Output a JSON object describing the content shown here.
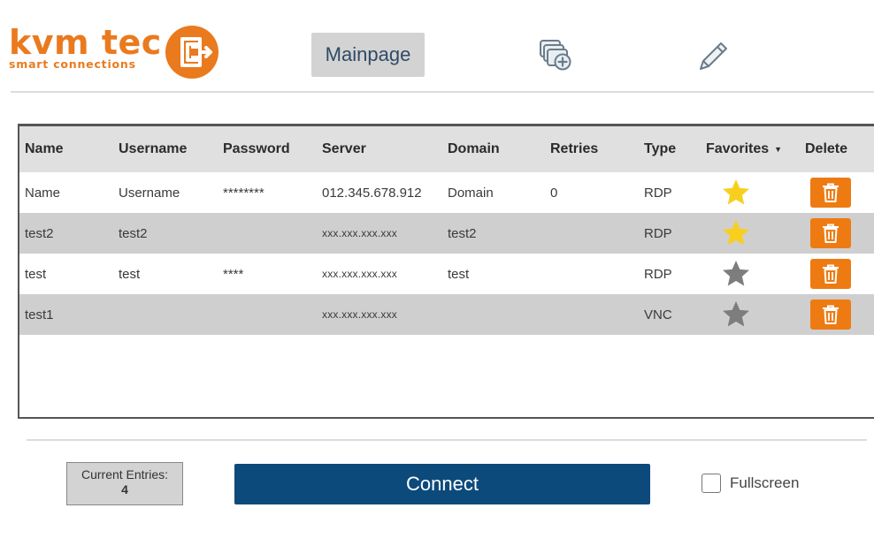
{
  "brand": {
    "name": "kvm tec",
    "tagline": "smart connections",
    "color": "#ea7a1e"
  },
  "nav": {
    "mainpage_label": "Mainpage",
    "add_icon": "add-connection-icon",
    "edit_icon": "pencil-icon"
  },
  "table": {
    "headers": {
      "name": "Name",
      "username": "Username",
      "password": "Password",
      "server": "Server",
      "domain": "Domain",
      "retries": "Retries",
      "type": "Type",
      "favorites": "Favorites",
      "delete": "Delete"
    },
    "rows": [
      {
        "name": "Name",
        "username": "Username",
        "password": "********",
        "server": "012.345.678.912",
        "domain": "Domain",
        "retries": "0",
        "type": "RDP",
        "favorite": true
      },
      {
        "name": "test2",
        "username": "test2",
        "password": "",
        "server": "xxx.xxx.xxx.xxx",
        "domain": "test2",
        "retries": "",
        "type": "RDP",
        "favorite": true
      },
      {
        "name": "test",
        "username": "test",
        "password": "****",
        "server": "xxx.xxx.xxx.xxx",
        "domain": "test",
        "retries": "",
        "type": "RDP",
        "favorite": false
      },
      {
        "name": "test1",
        "username": "",
        "password": "",
        "server": "xxx.xxx.xxx.xxx",
        "domain": "",
        "retries": "",
        "type": "VNC",
        "favorite": false
      }
    ]
  },
  "footer": {
    "entries_label": "Current Entries:",
    "entries_count": "4",
    "connect_label": "Connect",
    "fullscreen_label": "Fullscreen",
    "fullscreen_checked": false
  },
  "colors": {
    "accent": "#ee7b12",
    "connect": "#0d4a7c",
    "star_on": "#f7cf1f",
    "star_off": "#7d7d7d",
    "row_alt": "#cfcfcf"
  }
}
